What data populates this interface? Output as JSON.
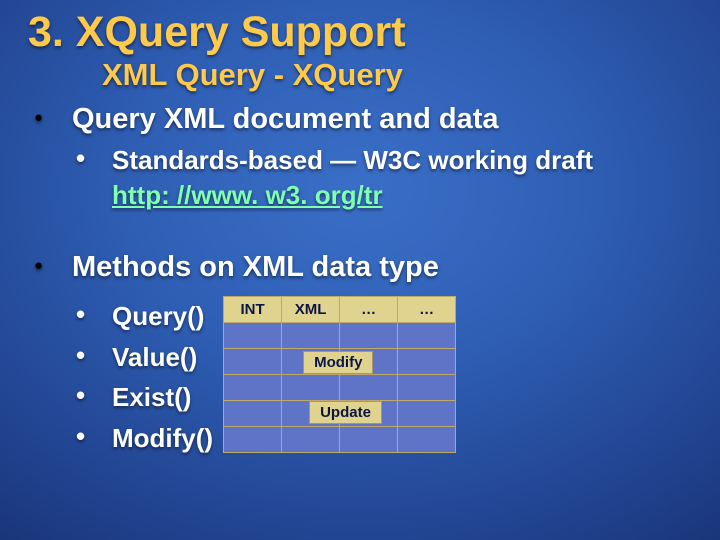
{
  "slide": {
    "title": "3.  XQuery Support",
    "subtitle": "XML Query - XQuery",
    "bullets": [
      {
        "text": "Query XML document and data",
        "sub": [
          {
            "text": "Standards-based — W3C working draft",
            "link_text": "http: //www. w3. org/tr"
          }
        ]
      },
      {
        "text": "Methods on XML data type",
        "sub": [
          {
            "text": "Query()"
          },
          {
            "text": "Value()"
          },
          {
            "text": "Exist()"
          },
          {
            "text": "Modify()"
          }
        ]
      }
    ]
  },
  "diagram": {
    "headers": [
      "INT",
      "XML",
      "…",
      "…"
    ],
    "rows": 5,
    "modify_label": "Modify",
    "update_label": "Update"
  }
}
